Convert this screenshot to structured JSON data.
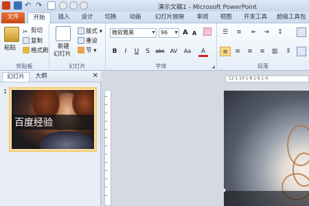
{
  "window": {
    "title": "演示文稿1 - Microsoft PowerPoint"
  },
  "tabs": [
    {
      "label": "文件"
    },
    {
      "label": "开始"
    },
    {
      "label": "插入"
    },
    {
      "label": "设计"
    },
    {
      "label": "切换"
    },
    {
      "label": "动画"
    },
    {
      "label": "幻灯片放映"
    },
    {
      "label": "审阅"
    },
    {
      "label": "视图"
    },
    {
      "label": "开发工具"
    },
    {
      "label": "超级工具包"
    }
  ],
  "ribbon": {
    "clipboard": {
      "paste": "粘贴",
      "cut": "剪切",
      "copy": "复制",
      "format_painter": "格式刷",
      "label": "剪贴板"
    },
    "slides": {
      "new_slide": "新建",
      "new_slide2": "幻灯片",
      "layout": "版式",
      "reset": "重设",
      "section": "节",
      "label": "幻灯片"
    },
    "font": {
      "font_name": "微软雅黑",
      "font_size": "96",
      "grow": "A",
      "shrink": "A",
      "bold": "B",
      "italic": "I",
      "underline": "U",
      "shadow": "S",
      "strike": "abc",
      "spacing": "AV",
      "case": "Aa",
      "color": "A",
      "label": "字体"
    },
    "paragraph": {
      "label": "段落"
    }
  },
  "panel": {
    "tab_slides": "幻灯片",
    "tab_outline": "大纲",
    "close": "✕",
    "slide_number": "1"
  },
  "slide": {
    "text": "百度经验"
  },
  "ruler": {
    "marks": "·12·1·10·1·8·1·6·1·4"
  },
  "icons": {
    "save": "save-icon",
    "undo": "undo-icon",
    "redo": "redo-icon"
  },
  "colors": {
    "file_tab": "#d55a22",
    "ribbon_bg": "#eef3fa",
    "selection": "#f3c96a"
  }
}
